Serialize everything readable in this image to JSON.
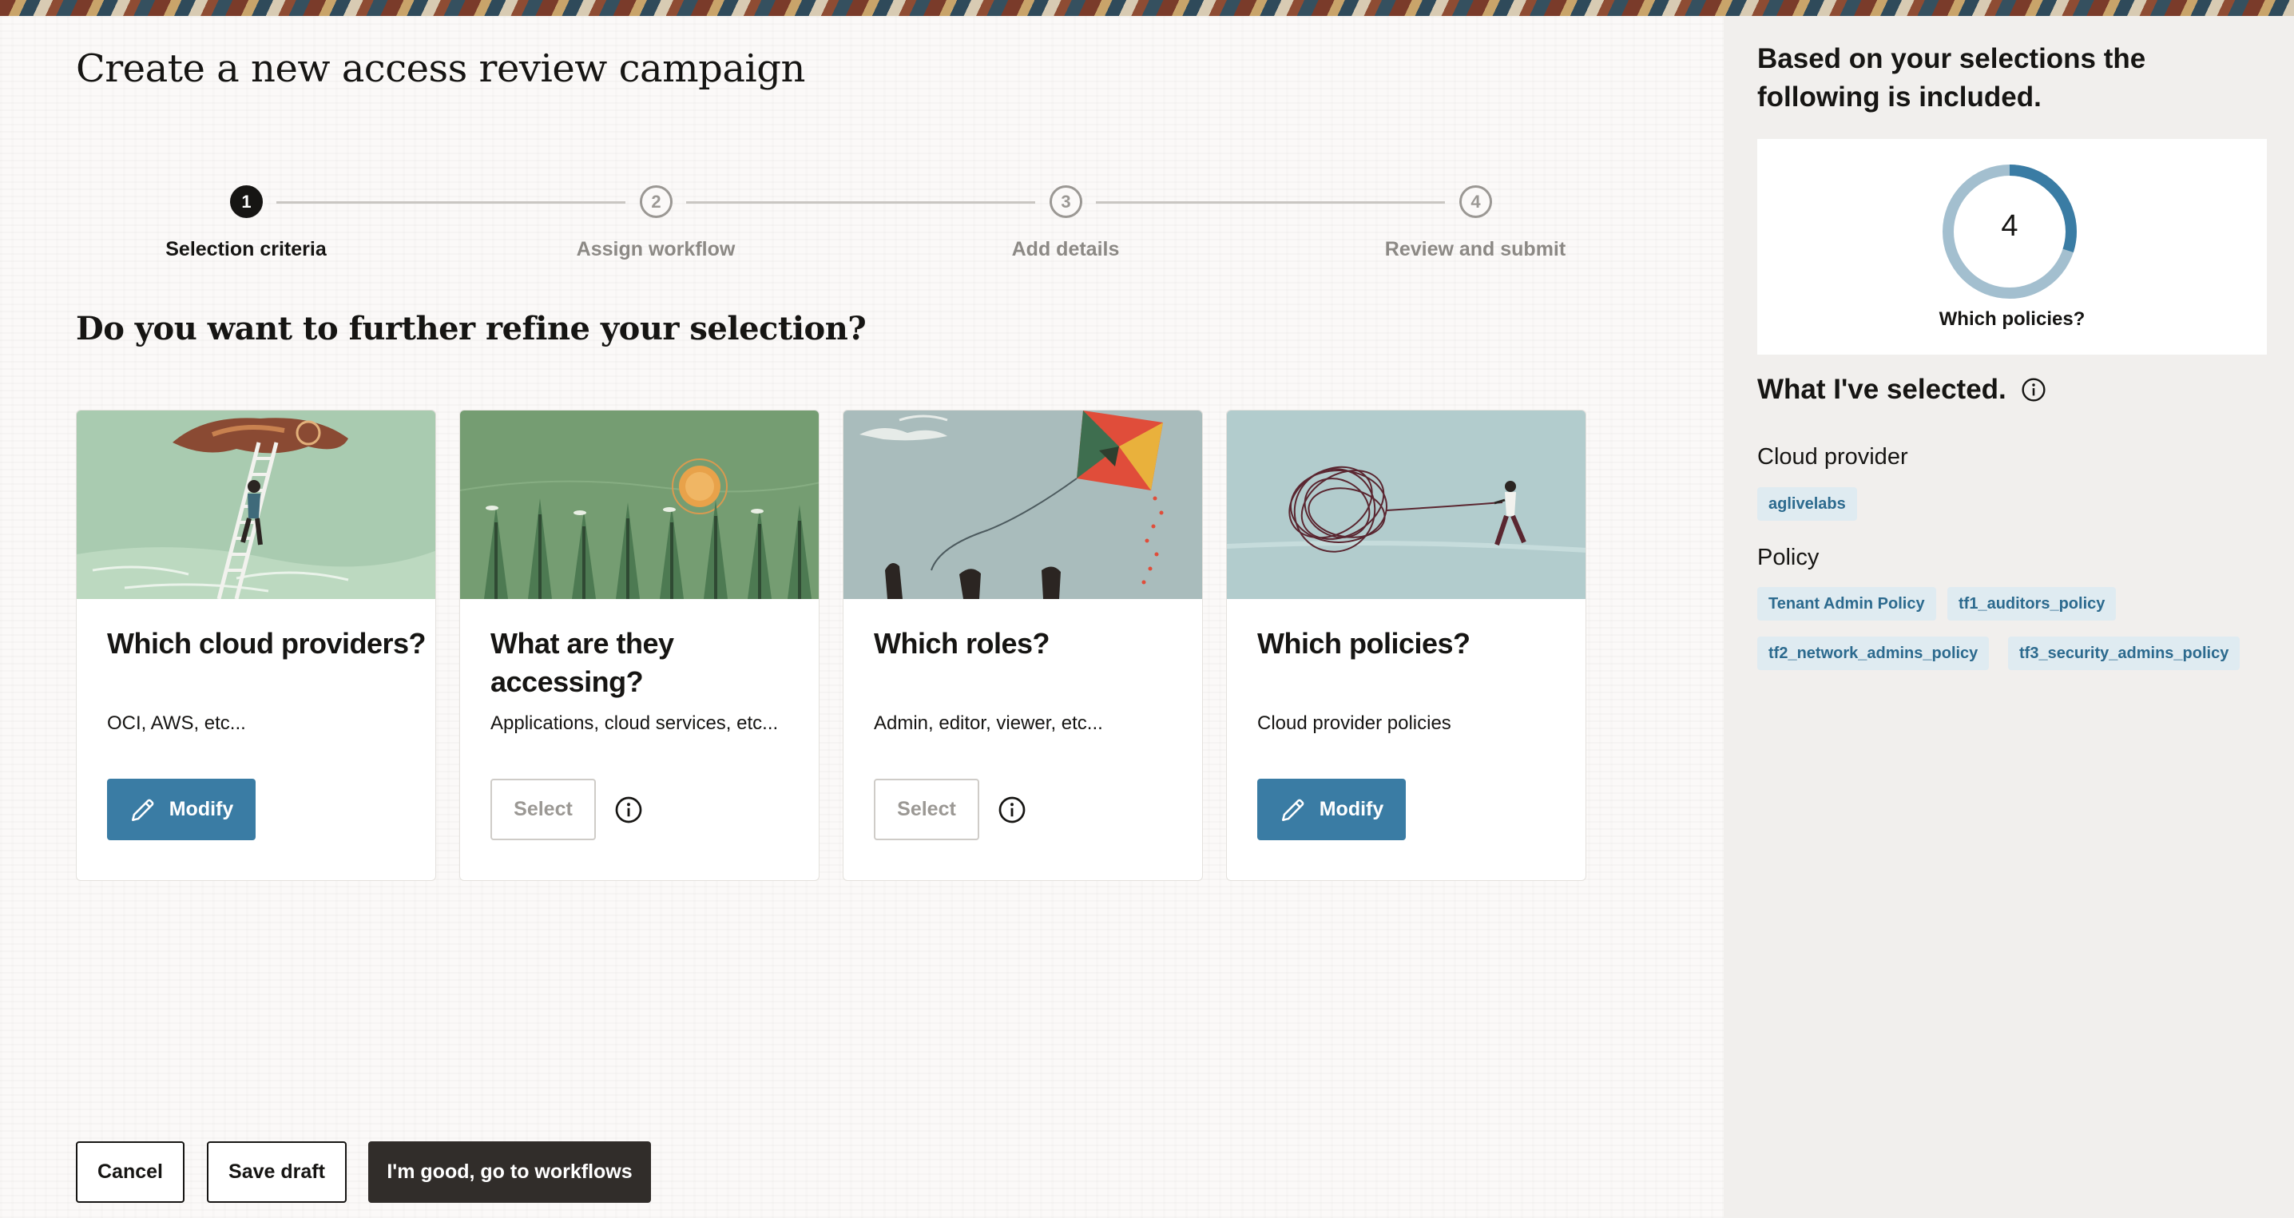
{
  "page": {
    "title": "Create a new access review campaign",
    "subtitle": "Do you want to further refine your selection?"
  },
  "stepper": {
    "steps": [
      {
        "number": "1",
        "label": "Selection criteria",
        "state": "active"
      },
      {
        "number": "2",
        "label": "Assign workflow",
        "state": "inactive"
      },
      {
        "number": "3",
        "label": "Add details",
        "state": "inactive"
      },
      {
        "number": "4",
        "label": "Review and submit",
        "state": "inactive"
      }
    ]
  },
  "cards": [
    {
      "title": "Which cloud providers?",
      "description": "OCI, AWS, etc...",
      "button": "Modify",
      "button_type": "modify",
      "illustration": "ladder-cloud-illustration"
    },
    {
      "title": "What are they accessing?",
      "description": "Applications, cloud services, etc...",
      "button": "Select",
      "button_type": "select",
      "illustration": "forest-sun-illustration"
    },
    {
      "title": "Which roles?",
      "description": "Admin, editor, viewer, etc...",
      "button": "Select",
      "button_type": "select",
      "illustration": "kite-hands-illustration"
    },
    {
      "title": "Which policies?",
      "description": "Cloud provider policies",
      "button": "Modify",
      "button_type": "modify",
      "illustration": "tangled-string-illustration"
    }
  ],
  "footer": {
    "cancel_label": "Cancel",
    "save_draft_label": "Save draft",
    "continue_label": "I'm good, go to workflows"
  },
  "side_panel": {
    "heading": "Based on your selections the following is included.",
    "summary": {
      "count": "4",
      "label": "Which policies?",
      "fill_fraction": 0.3
    },
    "selected_heading": "What I've selected.",
    "groups": [
      {
        "label": "Cloud provider",
        "chips": [
          "aglivelabs"
        ]
      },
      {
        "label": "Policy",
        "chips": [
          "Tenant Admin Policy",
          "tf1_auditors_policy",
          "tf2_network_admins_policy",
          "tf3_security_admins_policy"
        ]
      }
    ]
  },
  "colors": {
    "accent": "#3a7ca4",
    "dark_button": "#312d2a",
    "chip_bg": "#dfebf1",
    "chip_text": "#2c6a8e",
    "donut_track": "#a3bfcf",
    "donut_fill": "#3a7ca4"
  },
  "icons": {
    "modify": "pencil-icon",
    "info": "info-icon"
  }
}
